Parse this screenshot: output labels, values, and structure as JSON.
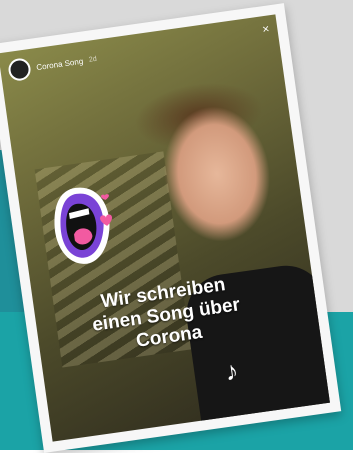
{
  "story": {
    "account_name": "Corona Song",
    "time": "2d",
    "caption_lines": [
      "Wir schreiben",
      "einen Song über",
      "Corona"
    ],
    "close_symbol": "×",
    "music_symbol": "♪"
  },
  "colors": {
    "background_gray": "#d9d9d9",
    "background_teal": "#1ba3a6",
    "accent_purple": "#7a43d6",
    "accent_pink": "#f25aa1"
  }
}
